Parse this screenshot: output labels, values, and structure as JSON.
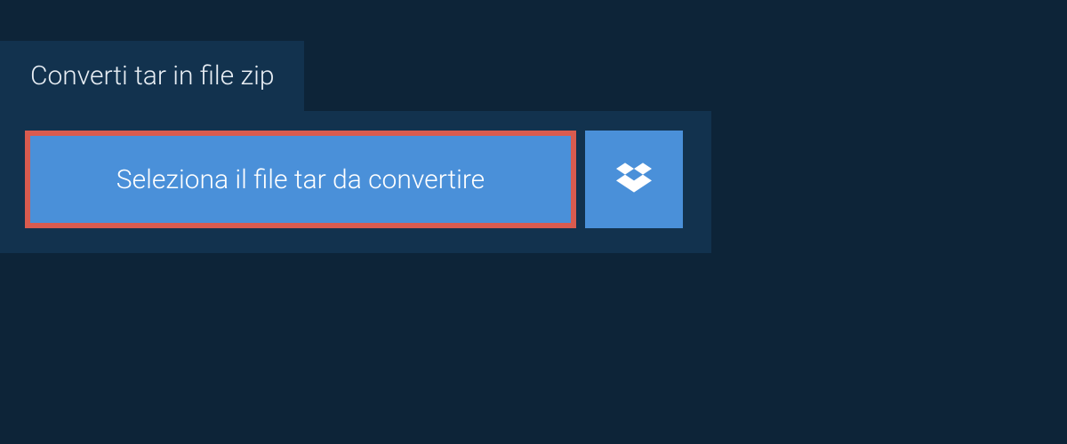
{
  "tab": {
    "title": "Converti tar in file zip"
  },
  "actions": {
    "select_file_label": "Seleziona il file tar da convertire",
    "dropbox_icon": "dropbox-icon"
  },
  "colors": {
    "page_bg": "#0d2438",
    "panel_bg": "#12324e",
    "button_bg": "#4a90d9",
    "highlight_border": "#d95b4f",
    "text_light": "#ffffff"
  }
}
